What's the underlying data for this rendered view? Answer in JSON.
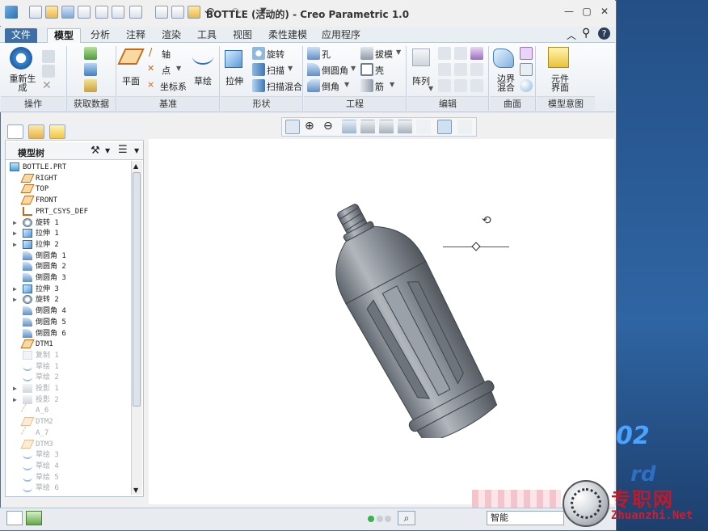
{
  "window": {
    "title": "BOTTLE (活动的) - Creo Parametric 1.0"
  },
  "tabs": [
    {
      "label": "文件"
    },
    {
      "label": "模型"
    },
    {
      "label": "分析"
    },
    {
      "label": "注释"
    },
    {
      "label": "渲染"
    },
    {
      "label": "工具"
    },
    {
      "label": "视图"
    },
    {
      "label": "柔性建模"
    },
    {
      "label": "应用程序"
    }
  ],
  "ribbon": {
    "regenerate": "重新生\n成",
    "plane": "平面",
    "axis": "轴",
    "point": "点",
    "csys": "坐标系",
    "sketch": "草绘",
    "extrude": "拉伸",
    "revolve": "旋转",
    "sweep": "扫描",
    "swept_blend": "扫描混合",
    "hole": "孔",
    "round": "倒圆角",
    "chamfer": "倒角",
    "draft": "拔模",
    "shell": "壳",
    "rib": "筋",
    "pattern": "阵列",
    "boundary_blend": "边界\n混合",
    "component_interface": "元件\n界面",
    "groups": {
      "operations": "操作",
      "get_data": "获取数据",
      "datum": "基准",
      "shapes": "形状",
      "engineering": "工程",
      "editing": "编辑",
      "surfaces": "曲面",
      "model_intent": "模型意图"
    }
  },
  "model_tree": {
    "header": "模型树",
    "items": [
      {
        "label": "BOTTLE.PRT",
        "indent": 0,
        "icon": "part",
        "expand": false,
        "dim": false
      },
      {
        "label": "RIGHT",
        "indent": 1,
        "icon": "plane",
        "expand": false,
        "dim": false
      },
      {
        "label": "TOP",
        "indent": 1,
        "icon": "plane",
        "expand": false,
        "dim": false
      },
      {
        "label": "FRONT",
        "indent": 1,
        "icon": "plane",
        "expand": false,
        "dim": false
      },
      {
        "label": "PRT_CSYS_DEF",
        "indent": 1,
        "icon": "csys",
        "expand": false,
        "dim": false
      },
      {
        "label": "旋转 1",
        "indent": 1,
        "icon": "revolve",
        "expand": true,
        "dim": false
      },
      {
        "label": "拉伸 1",
        "indent": 1,
        "icon": "extrude",
        "expand": true,
        "dim": false
      },
      {
        "label": "拉伸 2",
        "indent": 1,
        "icon": "extrude",
        "expand": true,
        "dim": false
      },
      {
        "label": "倒圆角 1",
        "indent": 1,
        "icon": "round",
        "expand": false,
        "dim": false
      },
      {
        "label": "倒圆角 2",
        "indent": 1,
        "icon": "round",
        "expand": false,
        "dim": false
      },
      {
        "label": "倒圆角 3",
        "indent": 1,
        "icon": "round",
        "expand": false,
        "dim": false
      },
      {
        "label": "拉伸 3",
        "indent": 1,
        "icon": "extrude",
        "expand": true,
        "dim": false
      },
      {
        "label": "旋转 2",
        "indent": 1,
        "icon": "revolve",
        "expand": true,
        "dim": false
      },
      {
        "label": "倒圆角 4",
        "indent": 1,
        "icon": "round",
        "expand": false,
        "dim": false
      },
      {
        "label": "倒圆角 5",
        "indent": 1,
        "icon": "round",
        "expand": false,
        "dim": false
      },
      {
        "label": "倒圆角 6",
        "indent": 1,
        "icon": "round",
        "expand": false,
        "dim": false
      },
      {
        "label": "DTM1",
        "indent": 1,
        "icon": "plane",
        "expand": false,
        "dim": false
      },
      {
        "label": "复制 1",
        "indent": 1,
        "icon": "copy",
        "expand": false,
        "dim": true
      },
      {
        "label": "草绘 1",
        "indent": 1,
        "icon": "sketch",
        "expand": false,
        "dim": true
      },
      {
        "label": "草绘 2",
        "indent": 1,
        "icon": "sketch",
        "expand": false,
        "dim": true
      },
      {
        "label": "投影 1",
        "indent": 1,
        "icon": "project",
        "expand": true,
        "dim": true
      },
      {
        "label": "投影 2",
        "indent": 1,
        "icon": "project",
        "expand": true,
        "dim": true
      },
      {
        "label": "A_6",
        "indent": 1,
        "icon": "axis",
        "expand": false,
        "dim": true
      },
      {
        "label": "DTM2",
        "indent": 1,
        "icon": "plane",
        "expand": false,
        "dim": true
      },
      {
        "label": "A_7",
        "indent": 1,
        "icon": "axis",
        "expand": false,
        "dim": true
      },
      {
        "label": "DTM3",
        "indent": 1,
        "icon": "plane",
        "expand": false,
        "dim": true
      },
      {
        "label": "草绘 3",
        "indent": 1,
        "icon": "sketch",
        "expand": false,
        "dim": true
      },
      {
        "label": "草绘 4",
        "indent": 1,
        "icon": "sketch",
        "expand": false,
        "dim": true
      },
      {
        "label": "草绘 5",
        "indent": 1,
        "icon": "sketch",
        "expand": false,
        "dim": true
      },
      {
        "label": "草绘 6",
        "indent": 1,
        "icon": "sketch",
        "expand": false,
        "dim": true
      }
    ]
  },
  "status": {
    "filter": "智能"
  },
  "watermark": {
    "cn": "专职网",
    "en": "Zhuanzhi.Net",
    "desktop_text": "02",
    "desktop_text2": "rd"
  },
  "colors": {
    "accent": "#3f6ea6",
    "model": "#8d939b",
    "datum": "#d61e1e"
  }
}
